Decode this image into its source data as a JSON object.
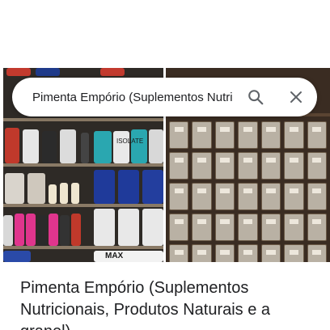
{
  "search": {
    "value": "Pimenta Empório (Suplementos Nutricionais, Produtos Naturais e a granel)",
    "search_icon": "magnifier",
    "clear_icon": "close-x"
  },
  "place": {
    "title": "Pimenta Empório (Suplementos Nutricionais, Produtos Naturais e a granel)"
  },
  "photos": {
    "left_label": "ISOLATE",
    "left_brand": "MAX"
  },
  "colors": {
    "text": "#202124",
    "icon": "#5f6368",
    "background": "#ffffff"
  }
}
